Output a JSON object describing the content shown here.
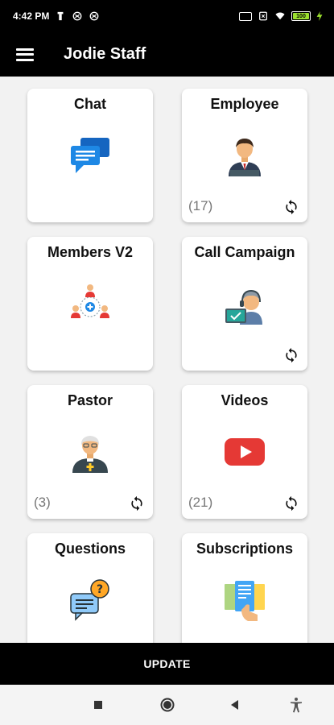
{
  "status_bar": {
    "time": "4:42 PM",
    "battery": "100"
  },
  "app_bar": {
    "title": "Jodie Staff"
  },
  "cards": [
    {
      "title": "Chat",
      "icon": "chat-bubbles-icon",
      "count": "",
      "sync": false
    },
    {
      "title": "Employee",
      "icon": "employee-icon",
      "count": "(17)",
      "sync": true
    },
    {
      "title": "Members V2",
      "icon": "members-network-icon",
      "count": "",
      "sync": false
    },
    {
      "title": "Call Campaign",
      "icon": "call-center-agent-icon",
      "count": "",
      "sync": true
    },
    {
      "title": "Pastor",
      "icon": "pastor-icon",
      "count": "(3)",
      "sync": true
    },
    {
      "title": "Videos",
      "icon": "youtube-play-icon",
      "count": "(21)",
      "sync": true
    },
    {
      "title": "Questions",
      "icon": "question-chat-icon",
      "count": "",
      "sync": false
    },
    {
      "title": "Subscriptions",
      "icon": "subscriptions-icon",
      "count": "",
      "sync": false
    }
  ],
  "footer": {
    "update_label": "UPDATE"
  },
  "colors": {
    "bar_background": "#000000",
    "page_background": "#f2f2f2",
    "chat_blue": "#1e88e5",
    "video_red": "#e53935",
    "battery_green": "#9be02e"
  }
}
